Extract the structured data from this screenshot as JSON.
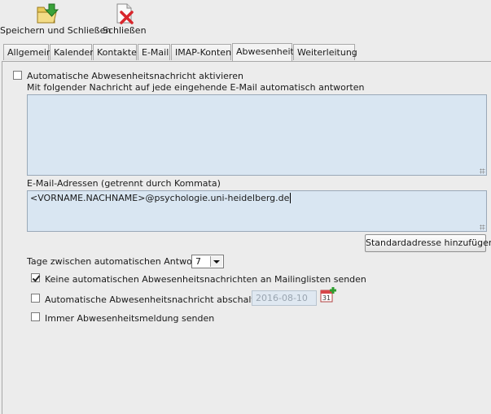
{
  "toolbar": {
    "save_close_label": "Speichern und Schließen",
    "close_label": "Schließen"
  },
  "tabs": [
    {
      "label": "Allgemein",
      "active": false
    },
    {
      "label": "Kalender",
      "active": false
    },
    {
      "label": "Kontakte",
      "active": false
    },
    {
      "label": "E-Mail",
      "active": false
    },
    {
      "label": "IMAP-Konten",
      "active": false
    },
    {
      "label": "Abwesenheit",
      "active": true
    },
    {
      "label": "Weiterleitung",
      "active": false
    }
  ],
  "absence": {
    "enable_label": "Automatische Abwesenheitsnachricht aktivieren",
    "enable_checked": false,
    "message_label": "Mit folgender Nachricht auf jede eingehende E-Mail automatisch antworten",
    "message_value": "",
    "addresses_label": "E-Mail-Adressen (getrennt durch Kommata)",
    "addresses_value": "<VORNAME.NACHNAME>@psychologie.uni-heidelberg.de",
    "add_default_button": "Standardadresse hinzufügen",
    "days_label": "Tage zwischen automatischen Antworten",
    "days_value": "7",
    "no_mailinglist_label": "Keine automatischen Abwesenheitsnachrichten an Mailinglisten senden",
    "no_mailinglist_checked": true,
    "auto_off_label": "Automatische Abwesenheitsnachricht abschalten am",
    "auto_off_checked": false,
    "auto_off_date": "2016-08-10",
    "always_send_label": "Immer Abwesenheitsmeldung senden",
    "always_send_checked": false
  }
}
